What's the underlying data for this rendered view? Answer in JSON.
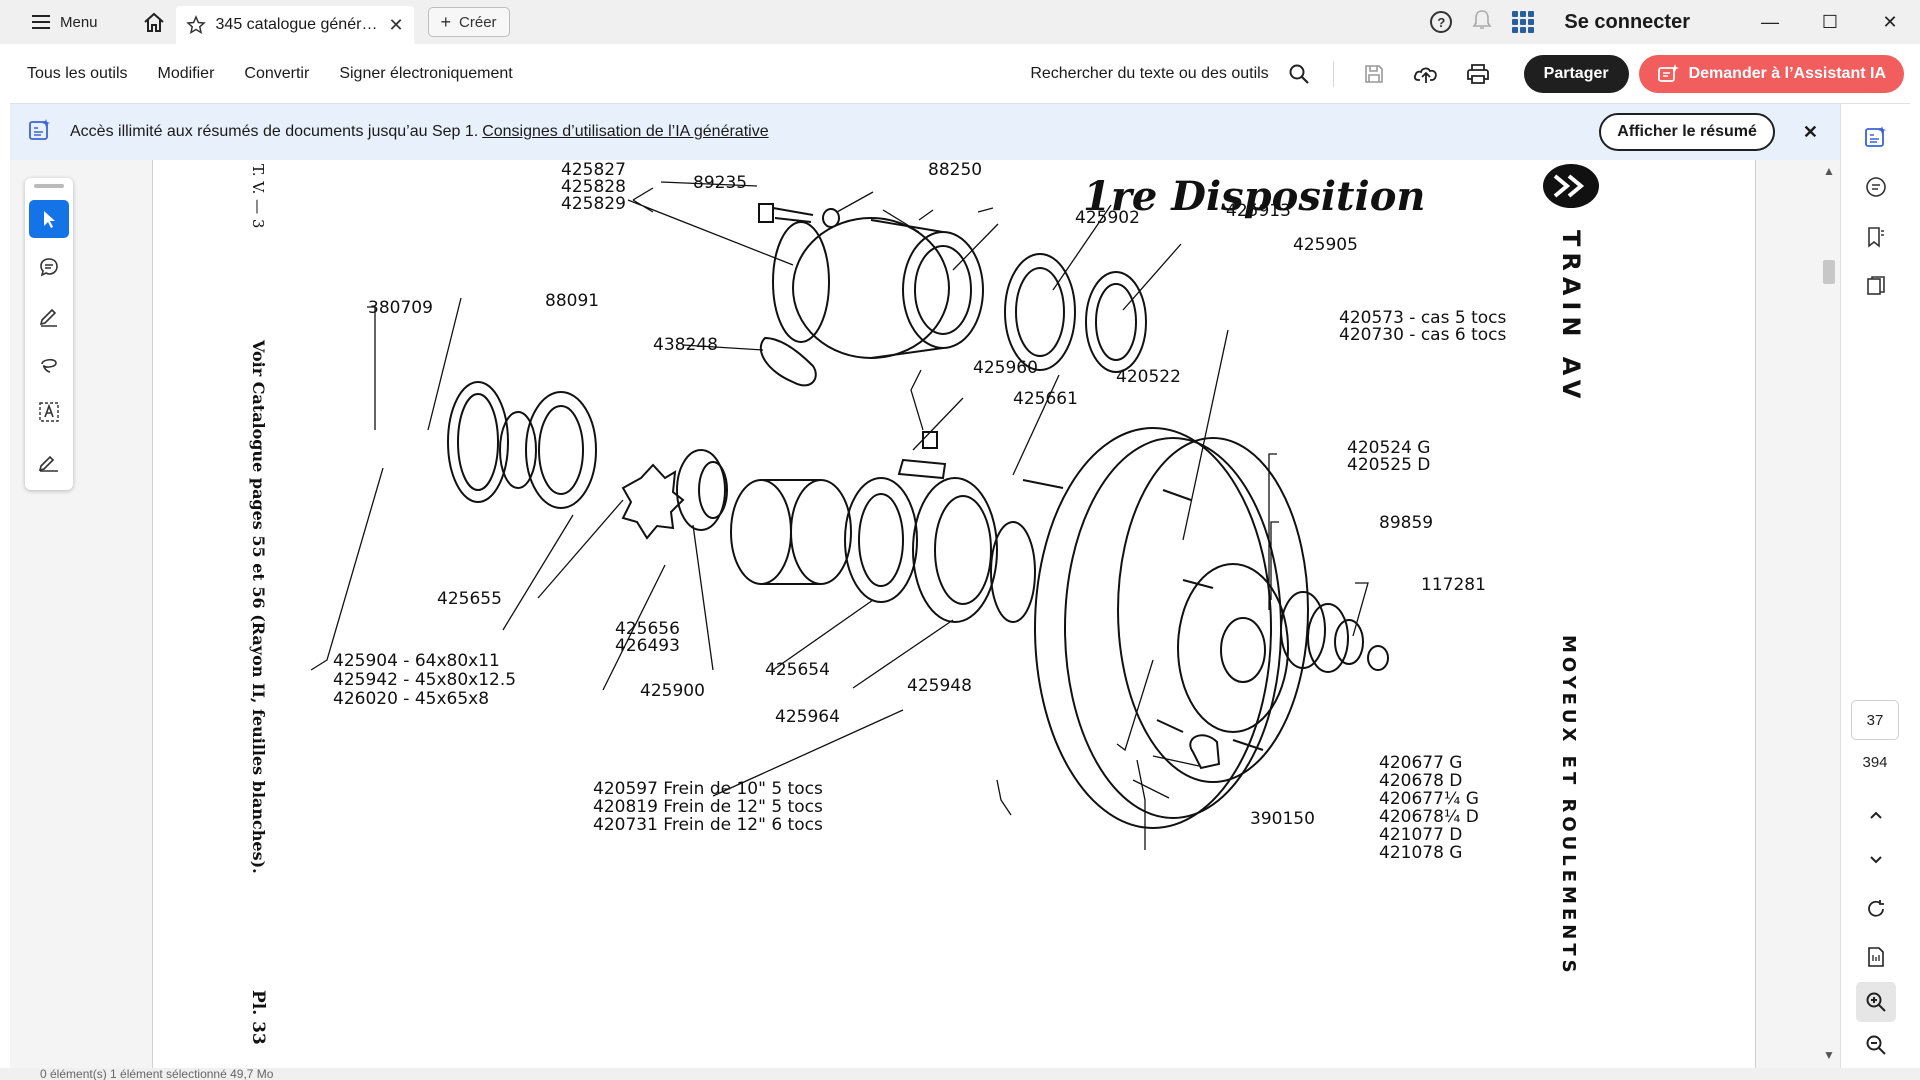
{
  "window": {
    "menu_label": "Menu",
    "tab_title": "345 catalogue général...",
    "create_label": "Créer",
    "signin_label": "Se connecter"
  },
  "toolbar": {
    "items": [
      "Tous les outils",
      "Modifier",
      "Convertir",
      "Signer électroniquement"
    ],
    "search_label": "Rechercher du texte ou des outils",
    "share_label": "Partager",
    "ai_label": "Demander à l’Assistant IA"
  },
  "banner": {
    "text": "Accès illimité aux résumés de documents jusqu’au Sep 1.",
    "link": "Consignes d’utilisation de l’IA générative",
    "summary_button": "Afficher le résumé"
  },
  "navigation": {
    "current_page": "37",
    "total_pages": "394"
  },
  "statusbar": {
    "text": "0 élément(s)     1 élément sélectionné  49,7 Mo"
  },
  "document": {
    "title": "1re Disposition",
    "header_code": "T. V. — 3",
    "side_title": "TRAIN AV",
    "side_subtitle": "MOYEUX ET ROULEMENTS",
    "left_note": "Voir Catalogue pages 55 et 56 (Rayon II, feuilles blanches).",
    "plate": "Pl. 33",
    "parts": {
      "p425827": "425827",
      "p425828": "425828",
      "p425829": "425829",
      "p89235": "89235",
      "p88250": "88250",
      "p425902": "425902",
      "p425913": "425913",
      "p425905": "425905",
      "p438248": "438248",
      "p380709": "380709",
      "p88091": "88091",
      "p420573": "420573 - cas 5 tocs",
      "p420730": "420730 - cas 6 tocs",
      "p425960": "425960",
      "p425661": "425661",
      "p420522": "420522",
      "p420524": "420524  G",
      "p420525": "420525  D",
      "p89859": "89859",
      "p117281": "117281",
      "p425655": "425655",
      "p425656": "425656",
      "p426493": "426493",
      "p425654": "425654",
      "p425948": "425948",
      "p425900": "425900",
      "p425964": "425964",
      "p425904": "425904  - 64x80x11",
      "p425942": "425942  - 45x80x12.5",
      "p426020": "426020  - 45x65x8",
      "p420597": "420597  Frein de 10\"   5 tocs",
      "p420819": "420819  Frein de 12\"   5 tocs",
      "p420731": "420731  Frein de 12\"   6 tocs",
      "p390150": "390150",
      "p420677": "420677  G",
      "p420678": "420678  D",
      "p420677b": "420677¼ G",
      "p420678b": "420678¼ D",
      "p421077": "421077  D",
      "p421078": "421078  G"
    }
  },
  "colors": {
    "accent": "#1473e6",
    "ai_button": "#f25e5e",
    "banner_bg": "#e8f1fb",
    "share_button": "#1f1f1f"
  }
}
